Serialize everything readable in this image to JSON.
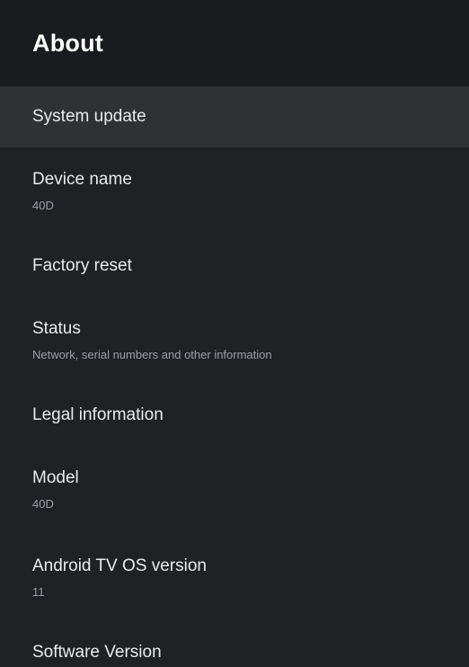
{
  "header": {
    "title": "About"
  },
  "items": [
    {
      "title": "System update",
      "subtitle": ""
    },
    {
      "title": "Device name",
      "subtitle": "40D"
    },
    {
      "title": "Factory reset",
      "subtitle": ""
    },
    {
      "title": "Status",
      "subtitle": "Network, serial numbers and other information"
    },
    {
      "title": "Legal information",
      "subtitle": ""
    },
    {
      "title": "Model",
      "subtitle": "40D"
    },
    {
      "title": "Android TV OS version",
      "subtitle": "11"
    },
    {
      "title": "Software Version",
      "subtitle": ""
    }
  ],
  "colors": {
    "background": "#202124",
    "header_background": "#1a1b1e",
    "focused_item_background": "#303134",
    "primary_text": "#e8eaed",
    "secondary_text": "#9aa0a6"
  }
}
